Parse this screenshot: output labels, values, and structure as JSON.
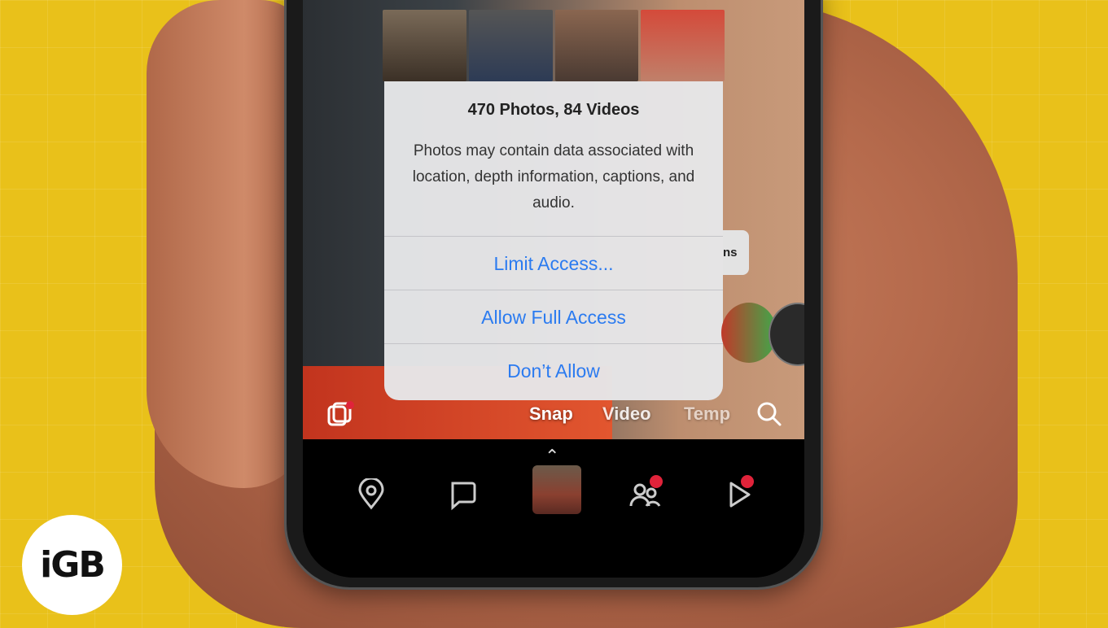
{
  "dialog": {
    "title": "470 Photos, 84 Videos",
    "body": "Photos may contain data associated with location, depth information, captions, and audio.",
    "buttons": [
      "Limit Access...",
      "Allow Full Access",
      "Don’t Allow"
    ]
  },
  "camera": {
    "side_label": "ns",
    "modes": [
      "Snap",
      "Video",
      "Temp"
    ]
  },
  "tabbar": {
    "items": [
      "map-pin-icon",
      "chat-icon",
      "camera-profile",
      "friends-icon",
      "stories-icon"
    ],
    "badge_color": "#e0233a"
  },
  "logo": {
    "text": "iGB"
  },
  "colors": {
    "accent": "#2b7bf0",
    "background": "#e9c11a"
  }
}
